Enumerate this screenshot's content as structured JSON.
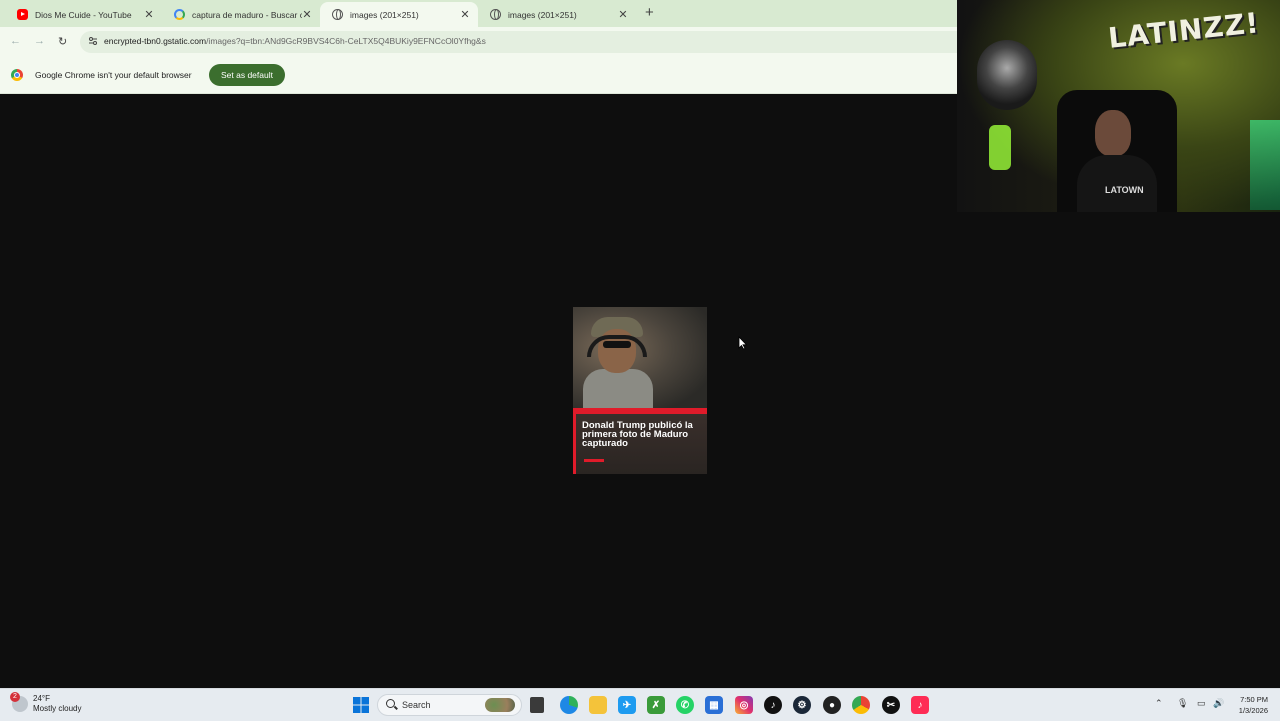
{
  "browser": {
    "tabs": [
      {
        "title": "Dios Me Cuide - YouTube",
        "icon": "youtube-icon"
      },
      {
        "title": "captura de maduro - Buscar con",
        "icon": "google-icon"
      },
      {
        "title": "images (201×251)",
        "icon": "globe-icon",
        "active": true
      },
      {
        "title": "images (201×251)",
        "icon": "globe-icon"
      }
    ],
    "url_host": "encrypted-tbn0.gstatic.com",
    "url_path": "/images?q=tbn:ANd9GcR9BVS4C6h-CeLTX5Q4BUKiy9EFNCcOl0Yfhg&s",
    "infobar_text": "Google Chrome isn't your default browser",
    "set_default_label": "Set as default"
  },
  "image": {
    "headline": "Donald Trump publicó la primera foto de Maduro capturado"
  },
  "webcam": {
    "graffiti": "LATINZZ!",
    "shirt_text": "LATOWN"
  },
  "taskbar": {
    "weather_temp": "24°F",
    "weather_desc": "Mostly cloudy",
    "weather_badge": "2",
    "search_label": "Search",
    "time": "7:50 PM",
    "date": "1/3/2026",
    "icons": [
      "start-icon",
      "search-icon",
      "file-icon",
      "edge-icon",
      "folder-icon",
      "twitter-icon",
      "xbox-icon",
      "whatsapp-icon",
      "store-icon",
      "instagram-icon",
      "tiktok-icon",
      "steam-icon",
      "obs-icon",
      "chrome-icon",
      "capcut-icon",
      "tiktok-studio-icon"
    ]
  },
  "colors": {
    "accent": "#3b6e2e",
    "page_bg": "#0e0e0e",
    "chrome_bg": "#e9f3e4",
    "red": "#e01b2a"
  }
}
